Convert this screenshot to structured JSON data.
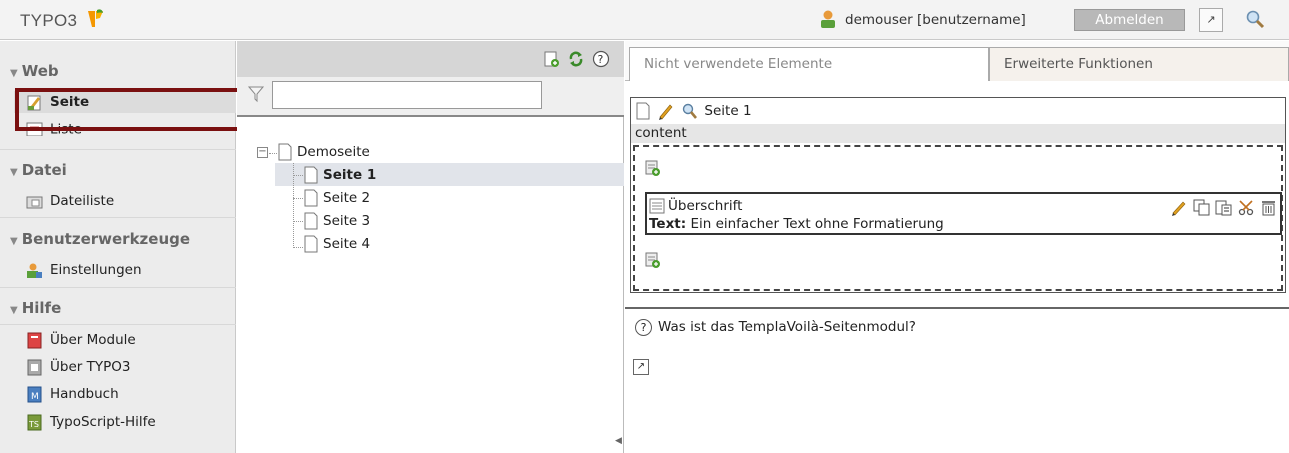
{
  "header": {
    "logo_text": "TYPO3",
    "user_label": "demouser [benutzername]",
    "logout_label": "Abmelden"
  },
  "modules": {
    "groups": [
      {
        "label": "Web",
        "items": [
          "Seite",
          "Liste"
        ]
      },
      {
        "label": "Datei",
        "items": [
          "Dateiliste"
        ]
      },
      {
        "label": "Benutzerwerkzeuge",
        "items": [
          "Einstellungen"
        ]
      },
      {
        "label": "Hilfe",
        "items": [
          "Über Module",
          "Über TYPO3",
          "Handbuch",
          "TypoScript-Hilfe"
        ]
      }
    ]
  },
  "tree": {
    "filter_value": "",
    "root": "Demoseite",
    "pages": [
      "Seite 1",
      "Seite 2",
      "Seite 3",
      "Seite 4"
    ],
    "selected_index": 0
  },
  "content": {
    "tabs": [
      "Nicht verwendete Elemente",
      "Erweiterte Funktionen"
    ],
    "page_title": "Seite 1",
    "column_label": "content",
    "element_title": "Überschrift",
    "element_text_label": "Text:",
    "element_text": "Ein einfacher Text ohne Formatierung",
    "help_text": "Was ist das TemplaVoilà-Seitenmodul?",
    "help_glyph": "?"
  },
  "colors": {
    "highlight_border": "#7a1010",
    "logo_orange": "#f49700",
    "logout_bg": "#b8b8b8"
  }
}
